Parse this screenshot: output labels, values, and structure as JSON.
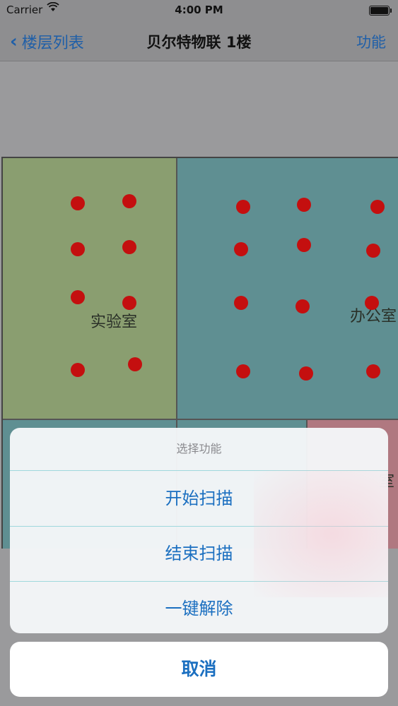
{
  "status_bar": {
    "carrier": "Carrier",
    "time": "4:00 PM",
    "wifi_icon": "wifi-icon",
    "battery_icon": "battery-icon"
  },
  "nav": {
    "back_label": "楼层列表",
    "title": "贝尔特物联 1楼",
    "right_label": "功能"
  },
  "floorplan": {
    "room_lab": "实验室",
    "room_office": "办公室",
    "room_bottom_right": "室",
    "colors": {
      "lab": "#8a9e70",
      "office": "#5f8f92",
      "bottom_right": "#b07880",
      "sensor_dot": "#c40f0f"
    },
    "sensor_count": 24
  },
  "action_sheet": {
    "title": "选择功能",
    "items": [
      "开始扫描",
      "结束扫描",
      "一键解除"
    ],
    "cancel": "取消",
    "accent_color": "#1b6fc0"
  }
}
